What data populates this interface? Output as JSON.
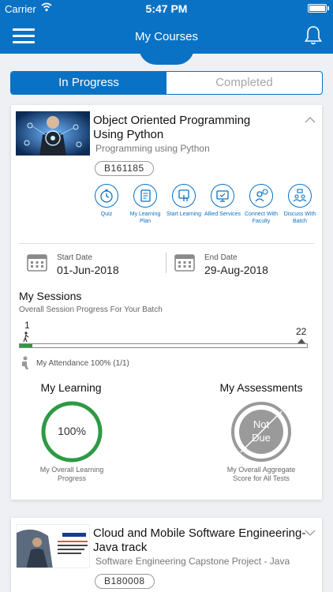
{
  "status_bar": {
    "carrier": "Carrier",
    "time": "5:47 PM"
  },
  "nav": {
    "title": "My Courses"
  },
  "tabs": [
    {
      "label": "In Progress",
      "active": true
    },
    {
      "label": "Completed",
      "active": false
    }
  ],
  "colors": {
    "primary": "#0a72c4",
    "progress": "#2e9a44",
    "not_due": "#9a9a9a"
  },
  "course1": {
    "title": "Object Oriented Programming Using Python",
    "subtitle": "Programming using Python",
    "batch": "B161185",
    "actions": [
      {
        "label": "Quiz",
        "icon": "stopwatch-icon"
      },
      {
        "label": "My Learning Plan",
        "icon": "notebook-icon"
      },
      {
        "label": "Start Learning",
        "icon": "touch-screen-icon"
      },
      {
        "label": "Allied Services",
        "icon": "monitor-icon"
      },
      {
        "label": "Connect With Faculty",
        "icon": "faculty-chat-icon"
      },
      {
        "label": "Discuss With Batch",
        "icon": "group-icon"
      }
    ],
    "start_date_label": "Start Date",
    "start_date": "01-Jun-2018",
    "end_date_label": "End Date",
    "end_date": "29-Aug-2018",
    "sessions_title": "My Sessions",
    "sessions_subtitle": "Overall Session Progress For Your Batch",
    "sessions_done": "1",
    "sessions_total": "22",
    "sessions_fraction": 0.045,
    "attendance": "My Attendance 100% (1/1)",
    "learning_title": "My Learning",
    "learning_value": "100%",
    "learning_fraction": 1.0,
    "learning_caption": "My Overall Learning Progress",
    "assessments_title": "My Assessments",
    "assessments_value": "Not Due",
    "assessments_caption": "My Overall Aggregate Score for All Tests"
  },
  "course2": {
    "title": "Cloud and Mobile Software Engineering- Java track",
    "subtitle": "Software Engineering Capstone Project - Java",
    "batch": "B180008"
  }
}
